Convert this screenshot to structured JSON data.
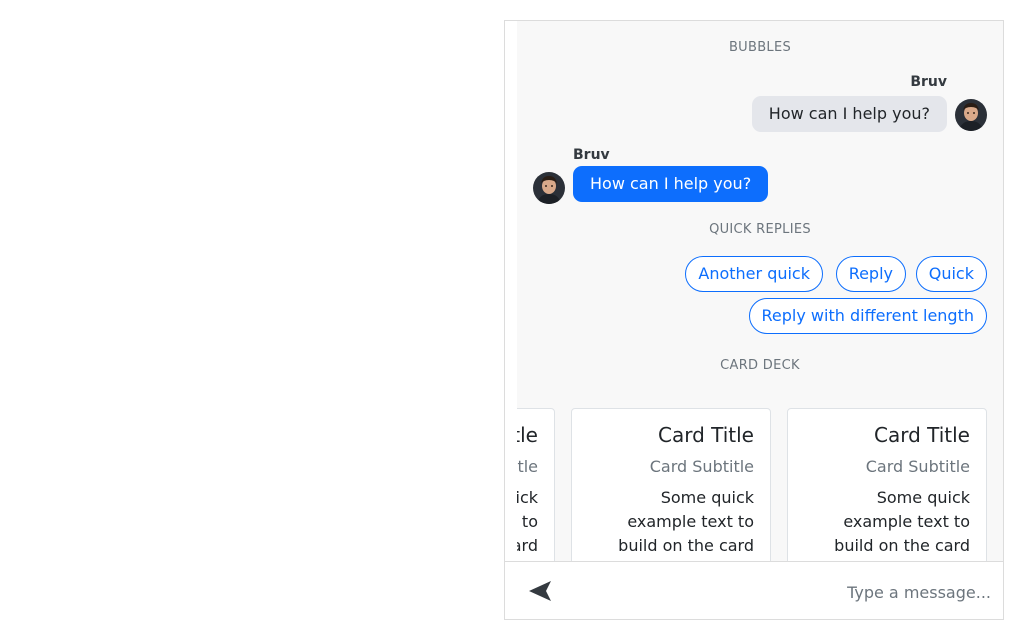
{
  "chat": {
    "sections": {
      "bubbles": "BUBBLES",
      "quick_replies": "QUICK REPLIES",
      "card_deck": "CARD DECK"
    },
    "bubbles": [
      {
        "sender": "Bruv",
        "text": "?How can I help you",
        "direction": "outgoing"
      },
      {
        "sender": "Bruv",
        "text": "?How can I help you",
        "direction": "incoming"
      }
    ],
    "quick_replies": [
      "Quick",
      "Reply",
      "Another quick",
      "Reply with different length"
    ],
    "cards": [
      {
        "title": "Card Title",
        "subtitle": "Card Subtitle",
        "text": "Some quick example text to build on the card"
      },
      {
        "title": "Card Title",
        "subtitle": "Card Subtitle",
        "text": "Some quick example text to build on the card"
      },
      {
        "title": "Card Title",
        "subtitle": "Card Subtitle",
        "text": "Some quick example text to build on the card"
      }
    ]
  },
  "input": {
    "placeholder": "...Type a message",
    "value": ""
  },
  "icons": {
    "send": "send-icon",
    "avatar": "avatar-image"
  },
  "colors": {
    "accent": "#0d6efd",
    "outgoing_bubble": "#e4e6eb",
    "panel_background": "#f8f8f8"
  }
}
